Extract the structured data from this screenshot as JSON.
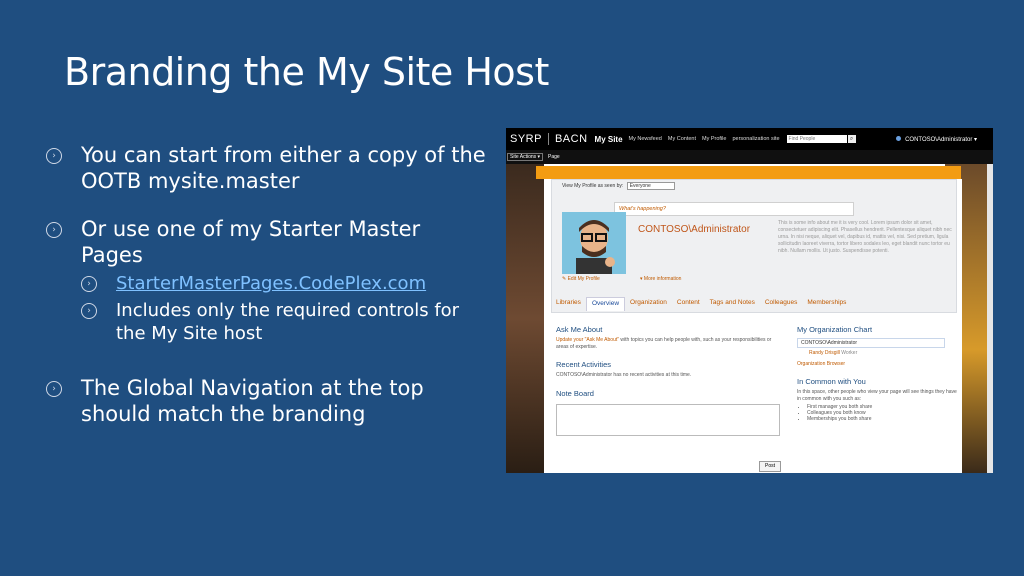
{
  "slide": {
    "title": "Branding the My Site Host",
    "bullets": [
      {
        "text": "You can start from either a copy of the OOTB mysite.master"
      },
      {
        "text": "Or use one of my Starter Master Pages"
      },
      {
        "text": "The Global Navigation at the top should match the branding"
      }
    ],
    "subbullets": [
      {
        "text": "StarterMasterPages.CodePlex.com"
      },
      {
        "text": "Includes only the required controls for the My Site host"
      }
    ]
  },
  "screenshot": {
    "logo_left": "SYRP",
    "logo_right": "BACN",
    "nav": [
      "My Site",
      "My Newsfeed",
      "My Content",
      "My Profile",
      "personalization site"
    ],
    "search_placeholder": "Find People",
    "search_btn": "⌕",
    "user": "CONTOSO\\Administrator ▾",
    "site_actions": "Site Actions ▾",
    "page_tab": "Page",
    "seen_by_label": "View My Profile as seen by:",
    "seen_by_value": "Everyone",
    "whats_happening": "What's happening?",
    "profile_name": "CONTOSO\\Administrator",
    "about_text": "This is some info about me it is very cool. Lorem ipsum dolor sit amet, consectetuer adipiscing elit. Phasellus hendrerit. Pellentesque aliquet nibh nec urna. In nisi neque, aliquet vel, dapibus id, mattis vel, nisi. Sed pretium, ligula sollicitudin laoreet viverra, tortor libero sodales leo, eget blandit nunc tortor eu nibh. Nullam mollis. Ut justo. Suspendisse potenti.",
    "edit_profile": "Edit My Profile",
    "more_info": "▾ More information",
    "tabs": [
      "Libraries",
      "Overview",
      "Organization",
      "Content",
      "Tags and Notes",
      "Colleagues",
      "Memberships"
    ],
    "ask_me_title": "Ask Me About",
    "ask_me_link": "Update your \"Ask Me About\"",
    "ask_me_text": " with topics you can help people with, such as your responsibilities or areas of expertise.",
    "recent_title": "Recent Activities",
    "recent_text": "CONTOSO\\Administrator has no recent activities at this time.",
    "note_title": "Note Board",
    "post_btn": "Post",
    "org_title": "My Organization Chart",
    "org_self": "CONTOSO\\Administrator",
    "org_sub_name": "Randy Drisgill",
    "org_sub_role": "Worker",
    "org_browser": "Organization Browser",
    "common_title": "In Common with You",
    "common_text": "In this space, other people who view your page will see things they have in common with you such as:",
    "common_items": [
      "First manager you both share",
      "Colleagues you both know",
      "Memberships you both share"
    ]
  }
}
